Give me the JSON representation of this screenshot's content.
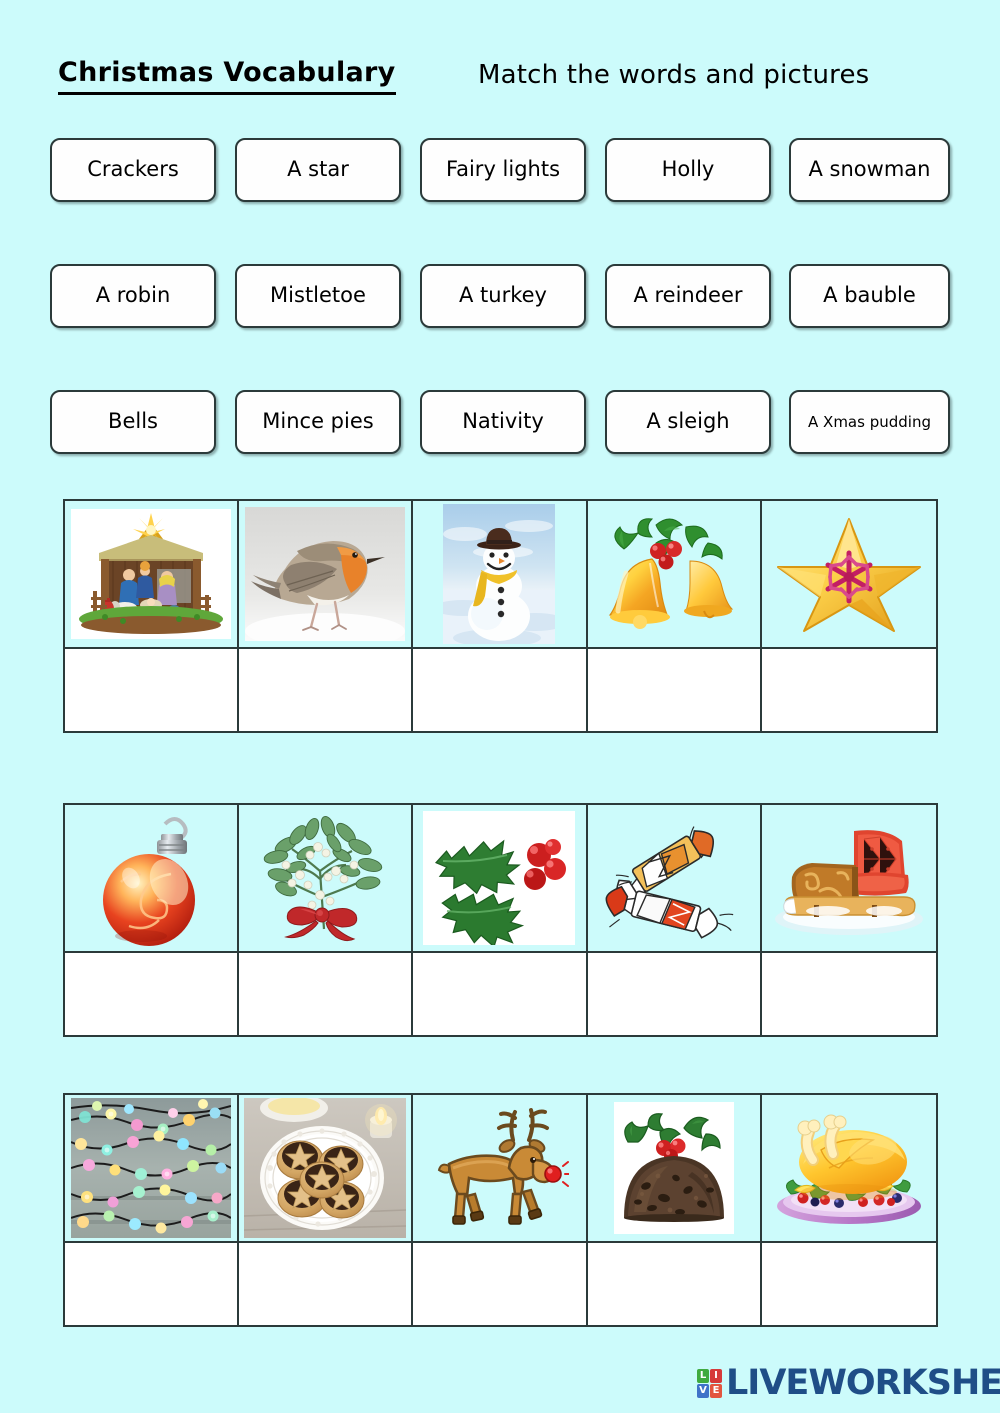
{
  "page": {
    "background_color": "#ccfbfb",
    "border_color": "#2b3a3a"
  },
  "header": {
    "title": "Christmas Vocabulary",
    "instruction": "Match the words and pictures"
  },
  "word_cards": {
    "rows": [
      [
        {
          "label": "Crackers",
          "size": "normal"
        },
        {
          "label": "A star",
          "size": "normal"
        },
        {
          "label": "Fairy lights",
          "size": "normal"
        },
        {
          "label": "Holly",
          "size": "normal"
        },
        {
          "label": "A snowman",
          "size": "normal"
        }
      ],
      [
        {
          "label": "A robin",
          "size": "normal"
        },
        {
          "label": "Mistletoe",
          "size": "normal"
        },
        {
          "label": "A turkey",
          "size": "normal"
        },
        {
          "label": "A reindeer",
          "size": "normal"
        },
        {
          "label": "A bauble",
          "size": "normal"
        }
      ],
      [
        {
          "label": "Bells",
          "size": "normal"
        },
        {
          "label": "Mince pies",
          "size": "normal"
        },
        {
          "label": "Nativity",
          "size": "normal"
        },
        {
          "label": "A sleigh",
          "size": "normal"
        },
        {
          "label": "A Xmas pudding",
          "size": "small"
        }
      ]
    ]
  },
  "picture_grids": [
    {
      "pictures": [
        {
          "name": "nativity-scene-image",
          "alt": "Nativity scene stable with figures and star"
        },
        {
          "name": "robin-bird-image",
          "alt": "Robin bird standing in snow"
        },
        {
          "name": "snowman-image",
          "alt": "Snowman with black hat and yellow scarf"
        },
        {
          "name": "bells-image",
          "alt": "Gold bells with holly and red berries"
        },
        {
          "name": "star-image",
          "alt": "Gold star with pink snowflake"
        }
      ],
      "answers": [
        "",
        "",
        "",
        "",
        ""
      ]
    },
    {
      "pictures": [
        {
          "name": "bauble-image",
          "alt": "Red Christmas bauble ornament"
        },
        {
          "name": "mistletoe-image",
          "alt": "Mistletoe sprig with red ribbon bow"
        },
        {
          "name": "holly-image",
          "alt": "Holly leaves with red berries"
        },
        {
          "name": "crackers-image",
          "alt": "Two Christmas crackers"
        },
        {
          "name": "sleigh-image",
          "alt": "Wooden sleigh with red seat"
        }
      ],
      "answers": [
        "",
        "",
        "",
        "",
        ""
      ]
    },
    {
      "pictures": [
        {
          "name": "fairy-lights-image",
          "alt": "Strings of coloured fairy lights"
        },
        {
          "name": "mince-pies-image",
          "alt": "Mince pies on a white plate"
        },
        {
          "name": "reindeer-image",
          "alt": "Cartoon reindeer with red nose"
        },
        {
          "name": "xmas-pudding-image",
          "alt": "Christmas pudding topped with holly"
        },
        {
          "name": "turkey-image",
          "alt": "Roast turkey on a platter"
        }
      ],
      "answers": [
        "",
        "",
        "",
        "",
        ""
      ]
    }
  ],
  "footer": {
    "brand_text": "LIVEWORKSHEETS",
    "badge_letters": [
      "L",
      "I",
      "V",
      "E"
    ],
    "badge_colors": [
      "#3faa3f",
      "#d63a3a",
      "#3f72c8",
      "#e2553f"
    ],
    "brand_color": "#1f4e87"
  }
}
